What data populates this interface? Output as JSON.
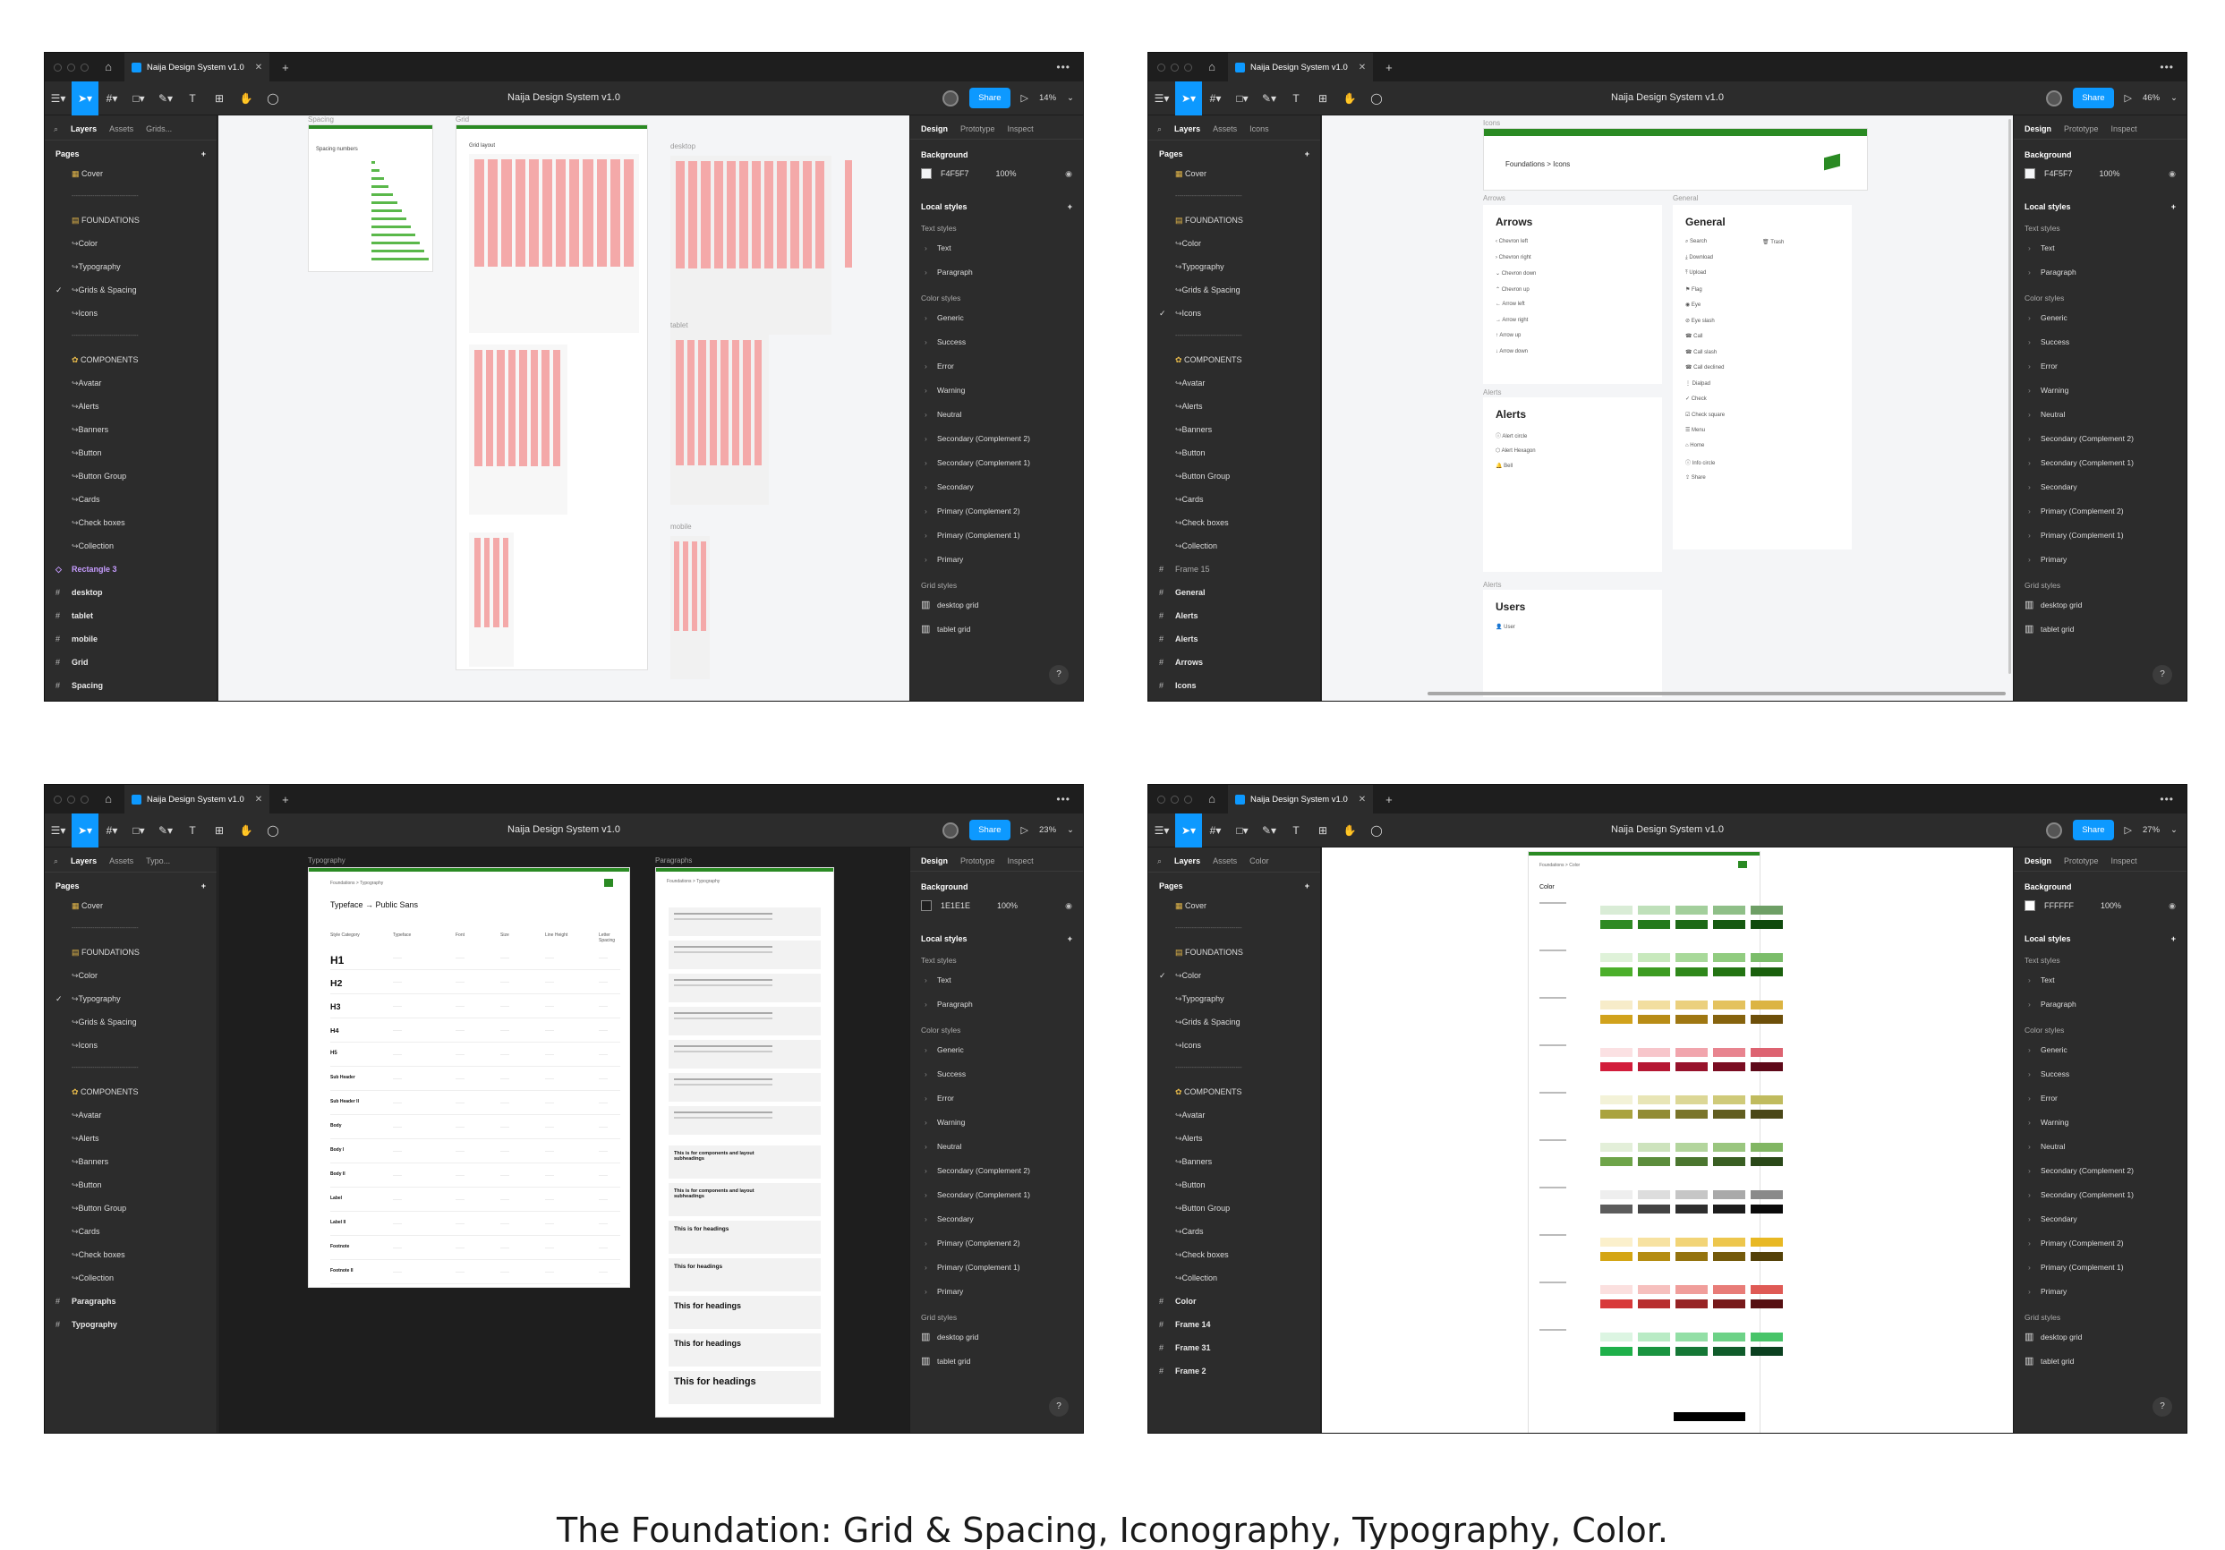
{
  "caption": "The Foundation: Grid & Spacing, Iconography, Typography, Color.",
  "file_tab": "Naija Design System v1.0",
  "doc_title": "Naija Design System v1.0",
  "share": "Share",
  "right_tabs": [
    "Design",
    "Prototype",
    "Inspect"
  ],
  "pages_label": "Pages",
  "background_label": "Background",
  "local_styles_label": "Local styles",
  "text_styles_label": "Text styles",
  "color_styles_label": "Color styles",
  "grid_styles_label": "Grid styles",
  "text_styles": [
    "Text",
    "Paragraph"
  ],
  "color_styles": [
    "Generic",
    "Success",
    "Error",
    "Warning",
    "Neutral",
    "Secondary (Complement 2)",
    "Secondary (Complement 1)",
    "Secondary",
    "Primary (Complement 2)",
    "Primary (Complement 1)",
    "Primary"
  ],
  "grid_styles": [
    "desktop grid",
    "tablet grid"
  ],
  "pages": [
    "Cover",
    "--------------------------------",
    "FOUNDATIONS",
    "Color",
    "Typography",
    "Grids & Spacing",
    "Icons",
    "--------------------------------",
    "COMPONENTS",
    "Avatar",
    "Alerts",
    "Banners",
    "Button",
    "Button Group",
    "Cards",
    "Check boxes",
    "Collection"
  ],
  "windows": [
    {
      "zoom": "14%",
      "left_tabs": [
        "Layers",
        "Assets",
        "Grids..."
      ],
      "bg_hex": "F4F5F7",
      "bg_opacity": "100%",
      "bg_color": "#F4F5F7",
      "active_page": 5,
      "layers": [
        "Rectangle 3",
        "desktop",
        "tablet",
        "mobile",
        "Grid",
        "Spacing"
      ],
      "canvas_labels": [
        "Spacing",
        "Grid",
        "desktop",
        "tablet",
        "mobile"
      ],
      "frame_text": [
        "Spacing numbers",
        "Grid layout"
      ]
    },
    {
      "zoom": "46%",
      "left_tabs": [
        "Layers",
        "Assets",
        "Icons"
      ],
      "bg_hex": "F4F5F7",
      "bg_opacity": "100%",
      "bg_color": "#F4F5F7",
      "active_page": 6,
      "layers": [
        "Frame 15",
        "General",
        "Alerts",
        "Alerts",
        "Arrows",
        "Icons"
      ],
      "breadcrumb": "Foundations  >  Icons",
      "canvas_labels": [
        "Icons",
        "Arrows",
        "General",
        "Alerts",
        "Alerts"
      ],
      "cards": {
        "arrows": "Arrows",
        "general": "General",
        "alerts": "Alerts",
        "users": "Users"
      },
      "arrows": [
        "Chevron left",
        "Chevron right",
        "Chevron down",
        "Chevron up",
        "Arrow left",
        "Arrow right",
        "Arrow up",
        "Arrow down"
      ],
      "general": [
        "Search",
        "Download",
        "Upload",
        "Flag",
        "Eye",
        "Eye slash",
        "Call",
        "Call slash",
        "Call declined",
        "Dialpad",
        "Check",
        "Check square",
        "Menu",
        "Home",
        "Info circle",
        "Share"
      ],
      "general_extra": "Trash",
      "alerts": [
        "Alert circle",
        "Alert Hexagon",
        "Bell"
      ],
      "users": [
        "User"
      ]
    },
    {
      "zoom": "23%",
      "left_tabs": [
        "Layers",
        "Assets",
        "Typo..."
      ],
      "bg_hex": "1E1E1E",
      "bg_opacity": "100%",
      "bg_color": "#1E1E1E",
      "active_page": 4,
      "layers": [
        "Paragraphs",
        "Typography"
      ],
      "canvas_labels": [
        "Typography",
        "Paragraphs"
      ],
      "breadcrumb": "Foundations  >  Typography",
      "typeface_title": "Typeface → Public Sans",
      "table_headers": [
        "Style Category",
        "Typeface",
        "Font",
        "Size",
        "Line Height",
        "Letter Spacing"
      ],
      "rows": [
        "H1",
        "H2",
        "H3",
        "H4",
        "H5",
        "Sub Header",
        "Sub Header II",
        "Body",
        "Body I",
        "Body II",
        "Label",
        "Label II",
        "Footnote",
        "Footnote II"
      ],
      "para_blocks": [
        "This is for components and layout subheadings",
        "This is for components and layout subheadings",
        "This is for headings",
        "This for headings",
        "This for headings",
        "This for headings",
        "This for headings"
      ]
    },
    {
      "zoom": "27%",
      "left_tabs": [
        "Layers",
        "Assets",
        "Color"
      ],
      "bg_hex": "FFFFFF",
      "bg_opacity": "100%",
      "bg_color": "#FFFFFF",
      "active_page": 3,
      "layers": [
        "Color",
        "Frame 14",
        "Frame 31",
        "Frame 2"
      ],
      "breadcrumb": "Foundations  >  Color",
      "color_title": "Color",
      "palette_groups": [
        {
          "light": [
            "#d9ecd6",
            "#bfe0ba",
            "#a3cf9c",
            "#8fbf88",
            "#6e9f66"
          ],
          "dark": [
            "#2f8a24",
            "#247a1b",
            "#1d6a16",
            "#165a11",
            "#0f4a0c"
          ]
        },
        {
          "light": [
            "#dff2d9",
            "#c8e9bd",
            "#a8d99a",
            "#91cc80",
            "#7bbd6a"
          ],
          "dark": [
            "#4caf2b",
            "#3d9c22",
            "#2f881b",
            "#237413",
            "#1a600d"
          ]
        },
        {
          "light": [
            "#f7ecc9",
            "#f2dea0",
            "#ebd07e",
            "#e4c25e",
            "#dcb442"
          ],
          "dark": [
            "#d1a21c",
            "#b88c16",
            "#9f7712",
            "#86630e",
            "#6d4f0a"
          ]
        },
        {
          "light": [
            "#fbe1e3",
            "#f7c6cb",
            "#f1a5ad",
            "#e8848f",
            "#dd6371"
          ],
          "dark": [
            "#d21d3b",
            "#b51733",
            "#97122b",
            "#7a0d22",
            "#5e0919"
          ]
        },
        {
          "light": [
            "#f3f2d8",
            "#e8e5b6",
            "#dcd796",
            "#cfca79",
            "#c0bb5e"
          ],
          "dark": [
            "#aaa33f",
            "#928c34",
            "#7a752a",
            "#625e20",
            "#4a4717"
          ]
        },
        {
          "light": [
            "#e3efd9",
            "#cde3bd",
            "#b3d59d",
            "#9ac67f",
            "#81b663"
          ],
          "dark": [
            "#6ea449",
            "#5c8d3c",
            "#4b762f",
            "#3a5f23",
            "#2a4818"
          ]
        },
        {
          "light": [
            "#eeeeee",
            "#dddddd",
            "#c6c6c6",
            "#a9a9a9",
            "#8a8a8a"
          ],
          "dark": [
            "#5c5c5c",
            "#444444",
            "#2e2e2e",
            "#1c1c1c",
            "#0a0a0a"
          ]
        },
        {
          "light": [
            "#fbf0cc",
            "#f7e2a1",
            "#f2d477",
            "#edc64d",
            "#e8b823"
          ],
          "dark": [
            "#d4a514",
            "#b48c11",
            "#94730e",
            "#745a0b",
            "#544108"
          ]
        },
        {
          "light": [
            "#fbe0df",
            "#f6c0be",
            "#f09e9b",
            "#e87c78",
            "#df5a55"
          ],
          "dark": [
            "#d8393a",
            "#b82e2f",
            "#972425",
            "#771a1b",
            "#561012"
          ]
        },
        {
          "light": [
            "#dcf5e2",
            "#b9ebc5",
            "#93dfa6",
            "#6dd287",
            "#48c469"
          ],
          "dark": [
            "#1fb04a",
            "#1a9440",
            "#157836",
            "#105c2b",
            "#0b4020"
          ]
        }
      ]
    }
  ]
}
